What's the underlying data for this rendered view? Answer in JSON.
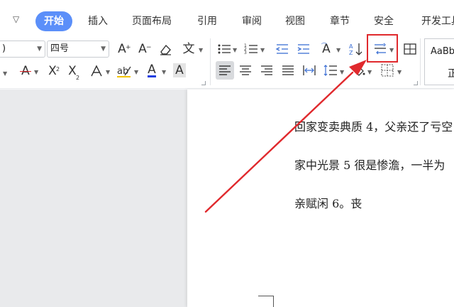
{
  "menu": {
    "tabs": [
      {
        "label": "开始",
        "active": true
      },
      {
        "label": "插入"
      },
      {
        "label": "页面布局"
      },
      {
        "label": "引用"
      },
      {
        "label": "审阅"
      },
      {
        "label": "视图"
      },
      {
        "label": "章节"
      },
      {
        "label": "安全"
      },
      {
        "label": "开发工具"
      }
    ],
    "caret": "▽"
  },
  "ribbon": {
    "font_name_value": ")",
    "font_size_value": "四号",
    "style_sample": "AaBb",
    "style_name": "正"
  },
  "document": {
    "lines": [
      "回家变卖典质 4，父亲还了亏空",
      "家中光景 5 很是惨澹，一半为",
      "亲赋闲 6。丧"
    ]
  },
  "annotation": {
    "highlight_color": "#e0292d",
    "arrow_color": "#e0292d",
    "target": "paragraph-spacing-button"
  },
  "colors": {
    "active_tab": "#5b8ff9",
    "workspace": "#e9eaec"
  }
}
